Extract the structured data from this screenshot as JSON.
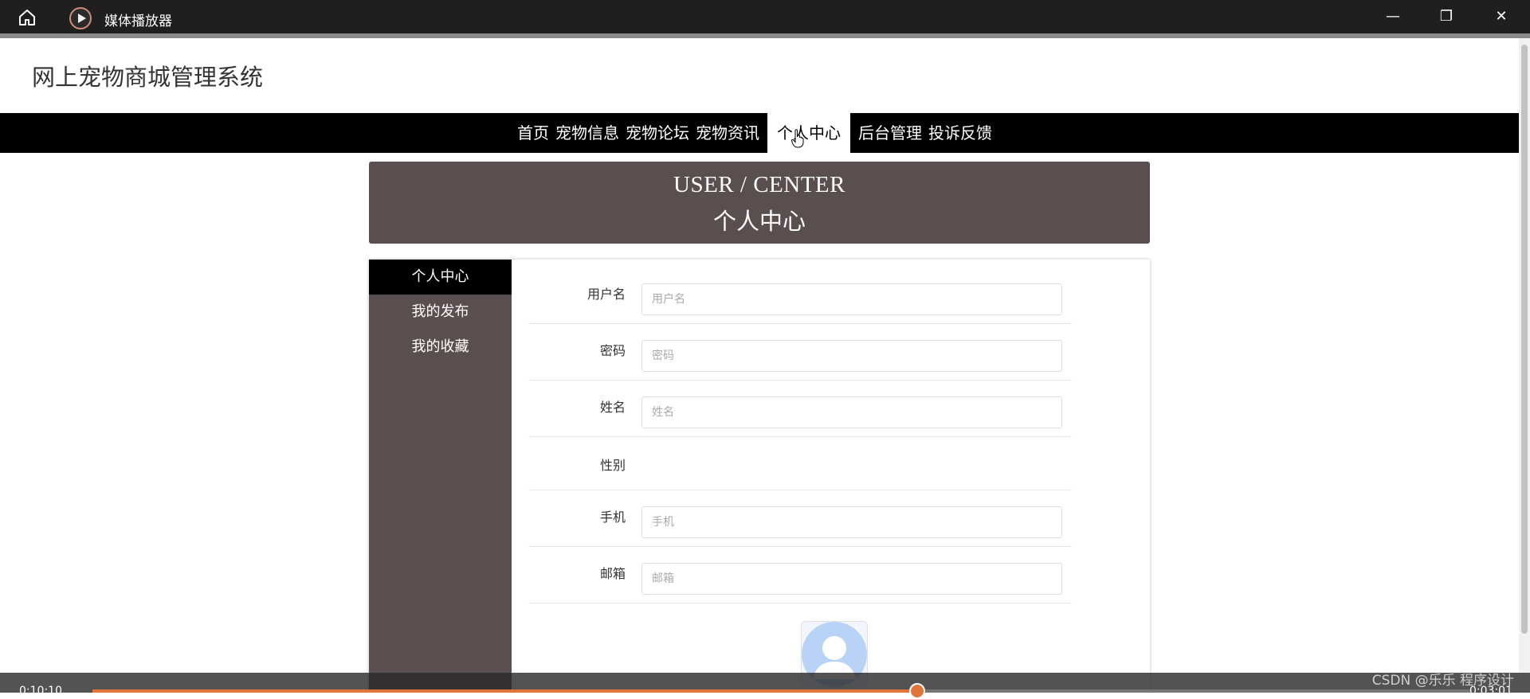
{
  "window": {
    "app_title": "媒体播放器",
    "minimize_glyph": "—",
    "maximize_glyph": "❐",
    "close_glyph": "✕"
  },
  "site": {
    "title": "网上宠物商城管理系统"
  },
  "nav": {
    "items": [
      {
        "label": "首页"
      },
      {
        "label": "宠物信息"
      },
      {
        "label": "宠物论坛"
      },
      {
        "label": "宠物资讯"
      },
      {
        "label": "个人中心"
      },
      {
        "label": "后台管理"
      },
      {
        "label": "投诉反馈"
      }
    ],
    "active": "个人中心"
  },
  "banner": {
    "en": "USER / CENTER",
    "cn": "个人中心"
  },
  "sidebar": {
    "items": [
      {
        "label": "个人中心"
      },
      {
        "label": "我的发布"
      },
      {
        "label": "我的收藏"
      }
    ]
  },
  "form": {
    "username": {
      "label": "用户名",
      "placeholder": "用户名"
    },
    "password": {
      "label": "密码",
      "placeholder": "密码"
    },
    "name": {
      "label": "姓名",
      "placeholder": "姓名"
    },
    "gender": {
      "label": "性别"
    },
    "phone": {
      "label": "手机",
      "placeholder": "手机"
    },
    "email": {
      "label": "邮箱",
      "placeholder": "邮箱"
    }
  },
  "player": {
    "elapsed": "0:10:10",
    "total": "0:03:01",
    "progress": 0.598,
    "accent": "#e0753a"
  },
  "watermark": "CSDN @乐乐 程序设计"
}
